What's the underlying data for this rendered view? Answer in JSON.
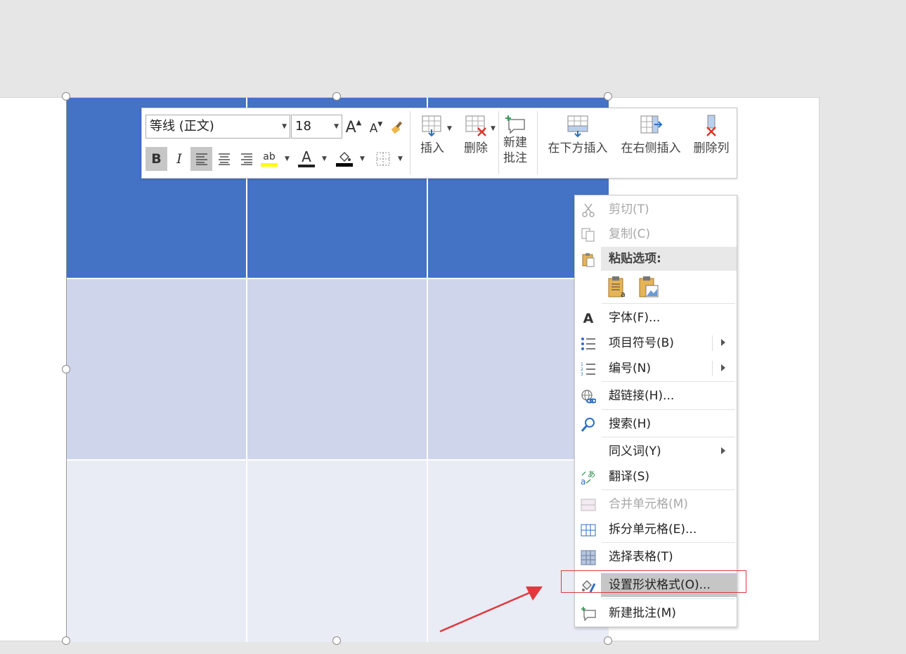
{
  "mini_toolbar": {
    "font_name": "等线 (正文)",
    "font_size": "18",
    "insert_label": "插入",
    "delete_label": "删除",
    "new_comment_label_1": "新建",
    "new_comment_label_2": "批注",
    "insert_below_label": "在下方插入",
    "insert_right_label": "在右侧插入",
    "delete_column_label": "删除列",
    "bold_glyph": "B",
    "italic_glyph": "I",
    "grow_font_glyph": "A",
    "shrink_font_glyph": "A",
    "font_color_glyph": "A",
    "highlight_glyph": "ab"
  },
  "context_menu": {
    "items": [
      {
        "label": "剪切(T)",
        "icon": "scissors-icon",
        "enabled": false
      },
      {
        "label": "复制(C)",
        "icon": "copy-icon",
        "enabled": false
      },
      {
        "label": "粘贴选项:",
        "icon": "clipboard-icon",
        "enabled": true
      },
      {
        "label": "字体(F)...",
        "icon": "font-icon",
        "enabled": true
      },
      {
        "label": "项目符号(B)",
        "icon": "bullets-icon",
        "enabled": true,
        "submenu": true
      },
      {
        "label": "编号(N)",
        "icon": "numbering-icon",
        "enabled": true,
        "submenu": true
      },
      {
        "label": "超链接(H)...",
        "icon": "hyperlink-icon",
        "enabled": true
      },
      {
        "label": "搜索(H)",
        "icon": "search-icon",
        "enabled": true
      },
      {
        "label": "同义词(Y)",
        "icon": "",
        "enabled": true,
        "submenu": true
      },
      {
        "label": "翻译(S)",
        "icon": "translate-icon",
        "enabled": true
      },
      {
        "label": "合并单元格(M)",
        "icon": "merge-cells-icon",
        "enabled": false
      },
      {
        "label": "拆分单元格(E)...",
        "icon": "split-cells-icon",
        "enabled": true
      },
      {
        "label": "选择表格(T)",
        "icon": "select-table-icon",
        "enabled": true
      },
      {
        "label": "设置形状格式(O)...",
        "icon": "format-shape-icon",
        "enabled": true,
        "highlighted": true
      },
      {
        "label": "新建批注(M)",
        "icon": "new-comment-icon",
        "enabled": true
      }
    ],
    "font_icon_glyph": "A"
  },
  "colors": {
    "header_row": "#4472c4",
    "band_row": "#cfd5ea",
    "light_row": "#e9ebf5",
    "annotation": "#e0393e",
    "font_color_bar": "#222222",
    "highlight_bar": "#ffff00"
  }
}
